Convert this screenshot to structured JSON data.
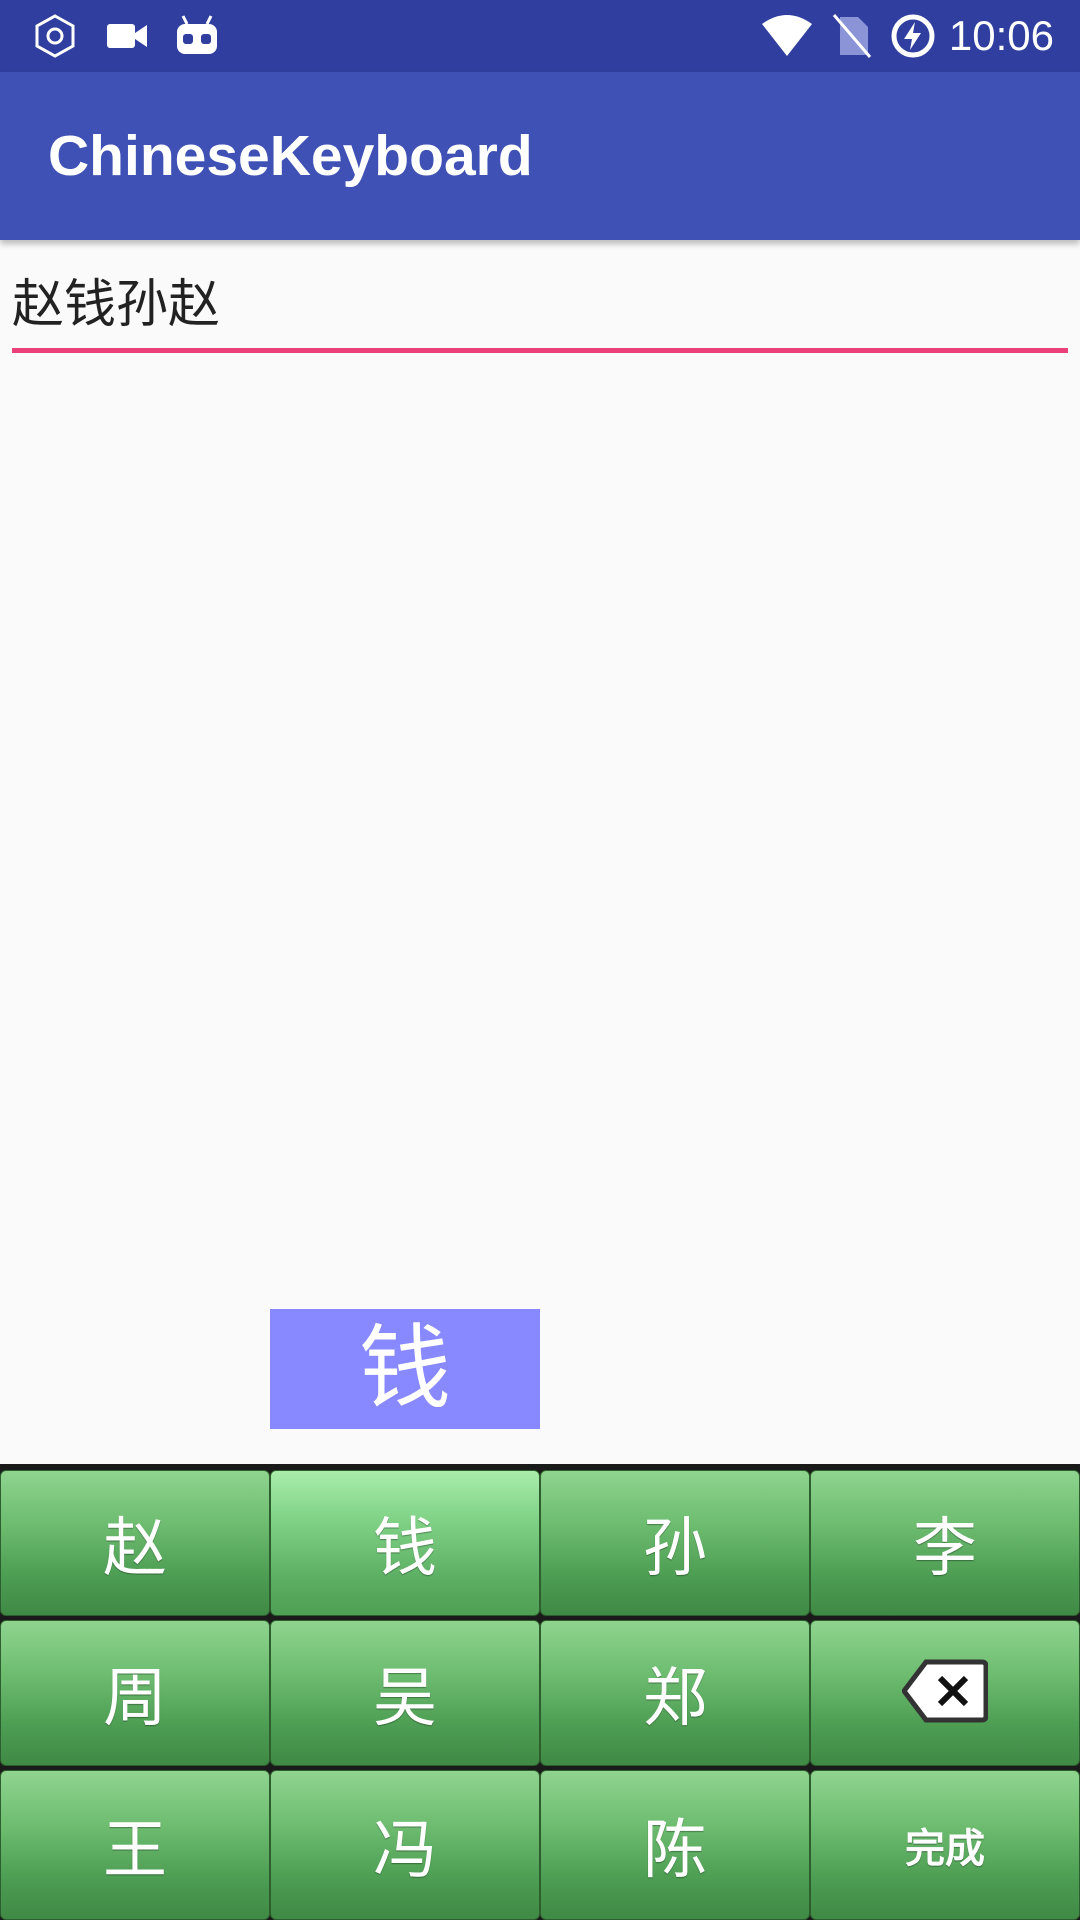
{
  "status_bar": {
    "time": "10:06",
    "icons": [
      "settings-hex-icon",
      "video-camera-icon",
      "android-robot-icon",
      "wifi-icon",
      "no-sim-icon",
      "battery-charging-icon"
    ]
  },
  "app_bar": {
    "title": "ChineseKeyboard"
  },
  "input": {
    "value": "赵钱孙赵",
    "underline_color": "#ec407a"
  },
  "key_preview": {
    "label": "钱"
  },
  "keyboard": {
    "rows": [
      [
        {
          "label": "赵"
        },
        {
          "label": "钱",
          "pressed": true
        },
        {
          "label": "孙"
        },
        {
          "label": "李"
        }
      ],
      [
        {
          "label": "周"
        },
        {
          "label": "吴"
        },
        {
          "label": "郑"
        },
        {
          "icon": "backspace-icon"
        }
      ],
      [
        {
          "label": "王"
        },
        {
          "label": "冯"
        },
        {
          "label": "陈"
        },
        {
          "label": "完成"
        }
      ]
    ]
  },
  "colors": {
    "status_bar": "#303f9f",
    "app_bar": "#3f51b5",
    "key_preview_bg": "#8888ff",
    "key_green": "#4f9f55"
  }
}
